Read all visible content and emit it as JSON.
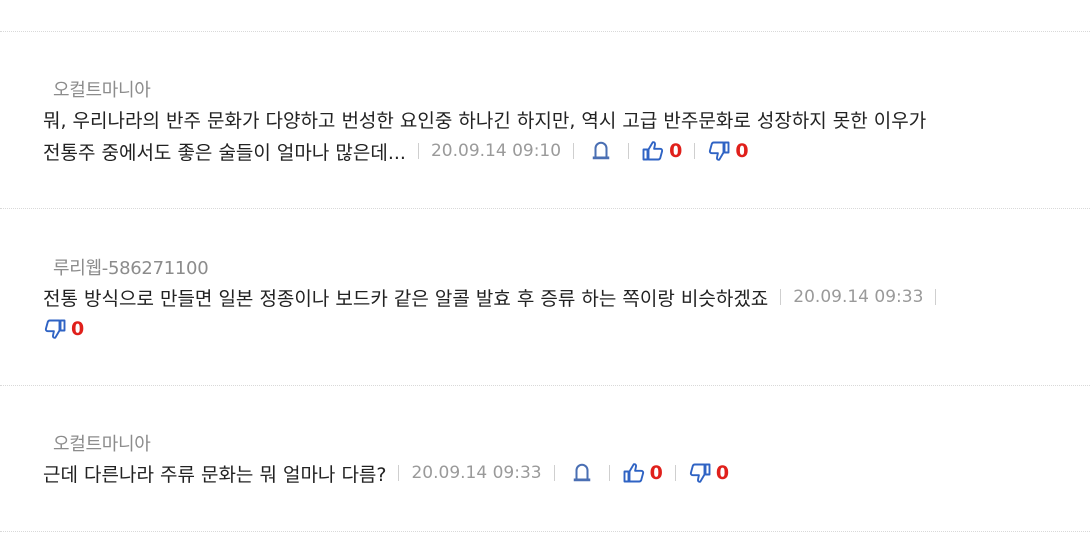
{
  "comments": [
    {
      "author": "오컬트마니아",
      "author_id": "",
      "text_line1": "뭐, 우리나라의 반주 문화가 다양하고 번성한 요인중 하나긴 하지만, 역시 고급 반주문화로 성장하지 못한 이우가",
      "text_line2": "전통주 중에서도 좋은 술들이 얼마나 많은데...",
      "date": "20.09.14 09:10",
      "likes": "0",
      "dislikes": "0"
    },
    {
      "author": "루리웹",
      "author_id": "-586271100",
      "text_line1": "전통 방식으로 만들면 일본 정종이나 보드카 같은 알콜 발효 후 증류 하는 쪽이랑 비슷하겠죠",
      "date": "20.09.14 09:33",
      "dislikes": "0"
    },
    {
      "author": "오컬트마니아",
      "author_id": "",
      "text_line1": "근데 다른나라 주류 문화는 뭐 얼마나 다름?",
      "date": "20.09.14 09:33",
      "likes": "0",
      "dislikes": "0"
    }
  ],
  "icons": {
    "report": "tombstone-report-icon",
    "like": "thumbs-up-icon",
    "dislike": "thumbs-down-icon"
  },
  "colors": {
    "count": "#e0201b",
    "icon": "#2f63c4",
    "meta": "#9a9a9a"
  }
}
